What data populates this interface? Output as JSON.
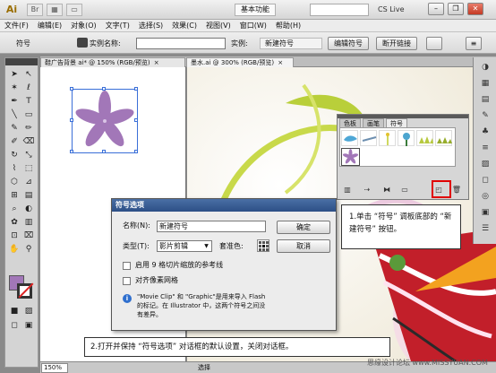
{
  "app": {
    "logo": "Ai",
    "workspace": "基本功能",
    "cs_live": "CS Live"
  },
  "menu": [
    "文件(F)",
    "编辑(E)",
    "对象(O)",
    "文字(T)",
    "选择(S)",
    "效果(C)",
    "视图(V)",
    "窗口(W)",
    "帮助(H)"
  ],
  "controlbar": {
    "selection_type": "符号",
    "instance_name_label": "实例名称:",
    "instance_name_value": "",
    "instance_label": "实例:",
    "instance_value": "新建符号",
    "edit_symbol": "编辑符号",
    "break_link": "断开链接"
  },
  "tabs": [
    {
      "label": "鞋广告背景 ai* @ 150% (RGB/预览)",
      "close": "×"
    },
    {
      "label": "墨水.ai @ 300% (RGB/预览)",
      "close": "×"
    }
  ],
  "symbols_panel": {
    "tabs": [
      "色板",
      "画笔",
      "符号"
    ]
  },
  "dialog": {
    "title": "符号选项",
    "name_label": "名称(N):",
    "name_value": "新建符号",
    "type_label": "类型(T):",
    "type_value": "影片剪辑",
    "registration_label": "套准色:",
    "ok": "确定",
    "cancel": "取消",
    "guides_checkbox": "启用 9 格切片缩放的参考线",
    "pixel_grid_checkbox": "对齐像素网格",
    "info_text": "\"Movie Clip\" 和 \"Graphic\"是用来导入 Flash 的标记。在 Illustrator 中，这两个符号之间没有差异。"
  },
  "callouts": {
    "step1": "1.单击 “符号” 调板底部的 “新建符号” 按钮。",
    "step2": "2.打开并保持 “符号选项” 对话框的默认设置，关闭对话框。"
  },
  "status": {
    "zoom": "150%",
    "selection_tool": "选择"
  },
  "watermark": "思缘设计论坛  www.MISSYUAN.COM",
  "colors": {
    "fill": "#a277b8",
    "accent_blue": "#2c4f86",
    "highlight_red": "#e00000"
  }
}
